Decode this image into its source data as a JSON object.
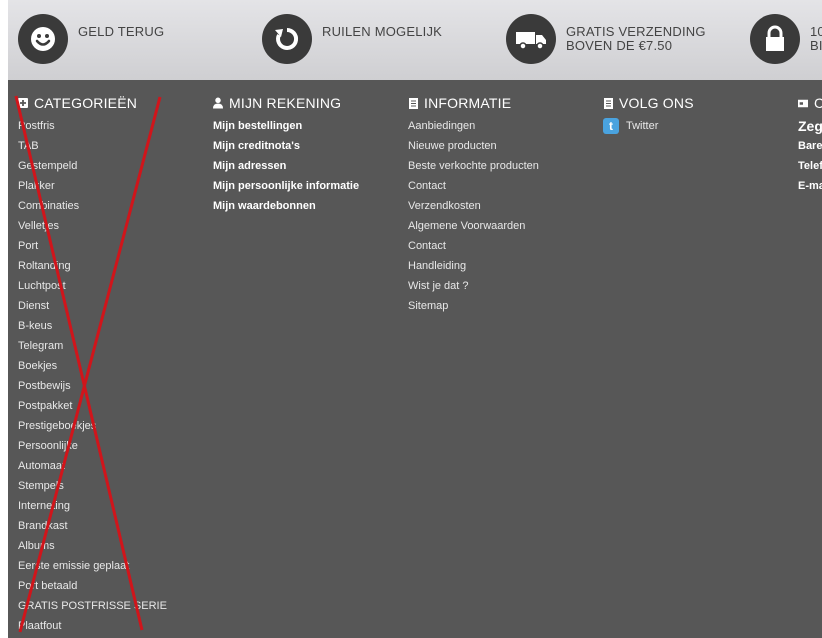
{
  "features": [
    {
      "icon": "smiley-icon",
      "text": "GELD TERUG"
    },
    {
      "icon": "refresh-icon",
      "text": "RUILEN MOGELIJK"
    },
    {
      "icon": "truck-icon",
      "text": "GRATIS VERZENDING\nBOVEN DE €7.50"
    },
    {
      "icon": "lock-icon",
      "text": "10\nBI"
    }
  ],
  "categories": {
    "title": "CATEGORIEËN",
    "items": [
      "Postfris",
      "TAB",
      "Gestempeld",
      "Plakker",
      "Combinaties",
      "Velletjes",
      "Port",
      "Roltanding",
      "Luchtpost",
      "Dienst",
      "B-keus",
      "Telegram",
      "Boekjes",
      "Postbewijs",
      "Postpakket",
      "Prestigeboekjes",
      "Persoonlijke",
      "Automaat",
      "Stempels",
      "Interneting",
      "Brandkast",
      "Albums",
      "Eerste emissie geplaat",
      "Port betaald",
      "GRATIS POSTFRISSE SERIE",
      "Plaatfout"
    ]
  },
  "account": {
    "title": "MIJN REKENING",
    "items": [
      "Mijn bestellingen",
      "Mijn creditnota's",
      "Mijn adressen",
      "Mijn persoonlijke informatie",
      "Mijn waardebonnen"
    ]
  },
  "information": {
    "title": "INFORMATIE",
    "items": [
      "Aanbiedingen",
      "Nieuwe producten",
      "Beste verkochte producten",
      "Contact",
      "Verzendkosten",
      "Algemene Voorwaarden",
      "Contact",
      "Handleiding",
      "Wist je dat ?",
      "Sitemap"
    ]
  },
  "follow": {
    "title": "VOLG ONS",
    "items": [
      "Twitter"
    ]
  },
  "contact": {
    "title": "C",
    "items": [
      "Zeg",
      "Bare",
      "Telef",
      "E-ma"
    ]
  },
  "colors": {
    "footer_bg": "#575757",
    "topbar": "#d9d9dc",
    "annotation": "#d0151b"
  }
}
